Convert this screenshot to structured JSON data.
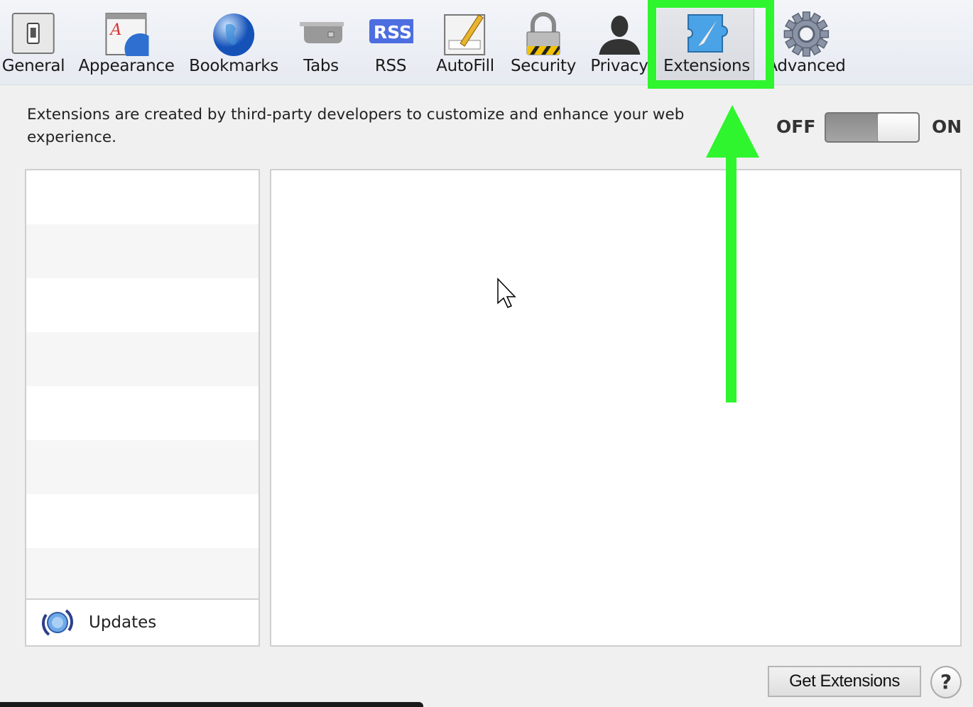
{
  "toolbar": {
    "items": [
      {
        "label": "General",
        "icon": "toggle-switch-icon"
      },
      {
        "label": "Appearance",
        "icon": "appearance-icon"
      },
      {
        "label": "Bookmarks",
        "icon": "globe-icon"
      },
      {
        "label": "Tabs",
        "icon": "tabs-icon"
      },
      {
        "label": "RSS",
        "icon": "rss-icon",
        "badge": "RSS"
      },
      {
        "label": "AutoFill",
        "icon": "autofill-pencil-icon"
      },
      {
        "label": "Security",
        "icon": "lock-icon"
      },
      {
        "label": "Privacy",
        "icon": "person-silhouette-icon"
      },
      {
        "label": "Extensions",
        "icon": "extensions-puzzle-icon",
        "selected": true
      },
      {
        "label": "Advanced",
        "icon": "gear-icon"
      }
    ]
  },
  "description": "Extensions are created by third-party developers to customize and enhance your web experience.",
  "toggle": {
    "off_label": "OFF",
    "on_label": "ON",
    "state": "on"
  },
  "sidebar": {
    "updates_label": "Updates"
  },
  "footer": {
    "get_extensions_label": "Get Extensions",
    "help_label": "?"
  },
  "annotation": {
    "highlight_color": "#2ef52e"
  }
}
